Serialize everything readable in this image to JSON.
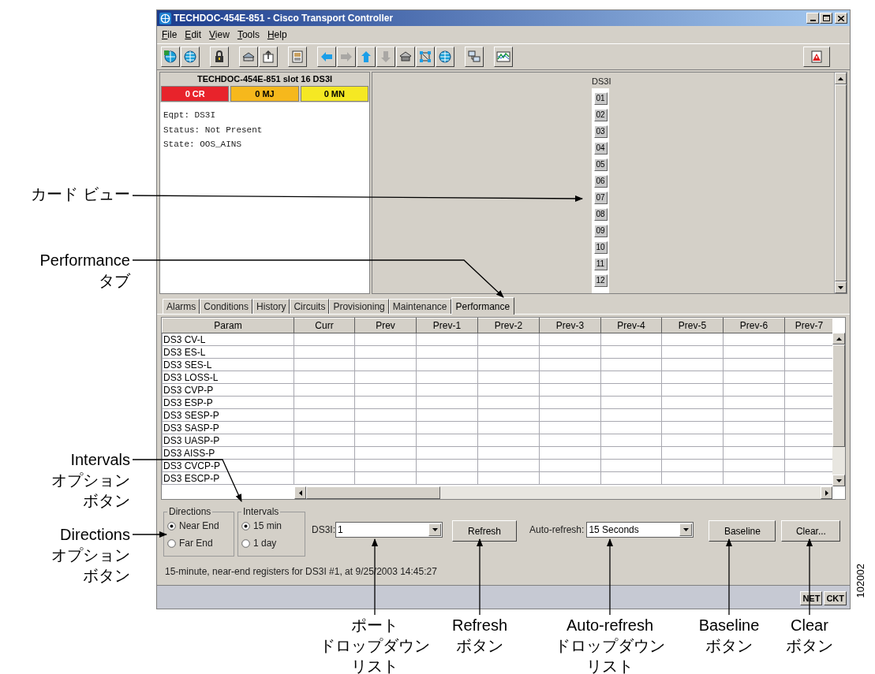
{
  "window": {
    "title": "TECHDOC-454E-851 - Cisco Transport Controller"
  },
  "menu": [
    "File",
    "Edit",
    "View",
    "Tools",
    "Help"
  ],
  "toolbar": [
    {
      "disabled": false
    },
    {
      "disabled": false
    },
    {
      "disabled": false
    },
    {
      "disabled": false
    },
    {
      "disabled": false
    },
    {
      "disabled": false
    },
    {
      "disabled": false
    },
    {
      "disabled": true
    },
    {
      "disabled": false
    },
    {
      "disabled": true
    },
    {
      "disabled": false
    },
    {
      "disabled": false
    },
    {
      "disabled": false
    },
    {
      "disabled": false
    },
    {
      "disabled": false
    },
    {
      "disabled": false
    }
  ],
  "card_panel": {
    "title": "TECHDOC-454E-851 slot 16 DS3I",
    "alarms": [
      {
        "label": "0 CR",
        "color": "#e8232b"
      },
      {
        "label": "0 MJ",
        "color": "#f6b81c"
      },
      {
        "label": "0 MN",
        "color": "#f5e823"
      }
    ],
    "info": [
      "Eqpt: DS3I",
      "Status: Not Present",
      "State: OOS_AINS"
    ]
  },
  "card_view": {
    "label": "DS3I",
    "ports": [
      "01",
      "02",
      "03",
      "04",
      "05",
      "06",
      "07",
      "08",
      "09",
      "10",
      "11",
      "12"
    ]
  },
  "tabs": [
    {
      "label": "Alarms",
      "selected": false
    },
    {
      "label": "Conditions",
      "selected": false
    },
    {
      "label": "History",
      "selected": false
    },
    {
      "label": "Circuits",
      "selected": false
    },
    {
      "label": "Provisioning",
      "selected": false
    },
    {
      "label": "Maintenance",
      "selected": false
    },
    {
      "label": "Performance",
      "selected": true
    }
  ],
  "table": {
    "columns": [
      "Param",
      "Curr",
      "Prev",
      "Prev-1",
      "Prev-2",
      "Prev-3",
      "Prev-4",
      "Prev-5",
      "Prev-6",
      "Prev-7"
    ],
    "rows": [
      "DS3 CV-L",
      "DS3 ES-L",
      "DS3 SES-L",
      "DS3 LOSS-L",
      "DS3 CVP-P",
      "DS3 ESP-P",
      "DS3 SESP-P",
      "DS3 SASP-P",
      "DS3 UASP-P",
      "DS3 AISS-P",
      "DS3 CVCP-P",
      "DS3 ESCP-P"
    ]
  },
  "directions": {
    "title": "Directions",
    "options": [
      {
        "label": "Near End",
        "selected": true
      },
      {
        "label": "Far End",
        "selected": false
      }
    ]
  },
  "intervals": {
    "title": "Intervals",
    "options": [
      {
        "label": "15 min",
        "selected": true
      },
      {
        "label": "1 day",
        "selected": false
      }
    ]
  },
  "port_select": {
    "label": "DS3I:",
    "value": "1"
  },
  "refresh_button": "Refresh",
  "auto_refresh": {
    "label": "Auto-refresh:",
    "value": "15 Seconds"
  },
  "baseline_button": "Baseline",
  "clear_button": "Clear...",
  "status_text": "15-minute, near-end registers for DS3I #1, at 9/25/2003 14:45:27",
  "status_bar": [
    "NET",
    "CKT"
  ],
  "callouts": [
    {
      "lines": [
        "カード ビュー"
      ]
    },
    {
      "lines": [
        "Performance",
        "タブ"
      ]
    },
    {
      "lines": [
        "Intervals",
        "オプション",
        "ボタン"
      ]
    },
    {
      "lines": [
        "Directions",
        "オプション",
        "ボタン"
      ]
    },
    {
      "lines": [
        "ポート",
        "ドロップダウン",
        "リスト"
      ]
    },
    {
      "lines": [
        "Refresh",
        "ボタン"
      ]
    },
    {
      "lines": [
        "Auto-refresh",
        "ドロップダウン",
        "リスト"
      ]
    },
    {
      "lines": [
        "Baseline",
        "ボタン"
      ]
    },
    {
      "lines": [
        "Clear",
        "ボタン"
      ]
    }
  ],
  "figure_number": "102002"
}
